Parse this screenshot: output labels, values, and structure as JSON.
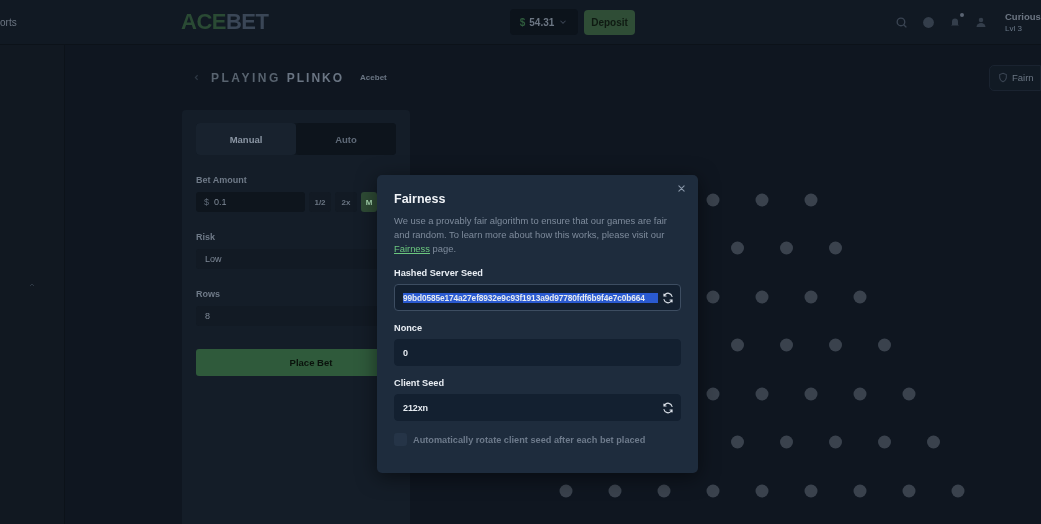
{
  "nav": {
    "label": "orts"
  },
  "header": {
    "logo": {
      "part_1": "ACE",
      "part_2": "BET"
    },
    "balance": {
      "currency": "$",
      "amount": "54.31"
    },
    "deposit": "Deposit",
    "notification_dot": true,
    "user": {
      "name": "Curious",
      "level": "Lvl 3"
    }
  },
  "game": {
    "title_prefix": "PLAYING",
    "title": "PLINKO",
    "provider": "Acebet",
    "fairness_button": "Fairn"
  },
  "controls": {
    "tabs": [
      {
        "label": "Manual",
        "selected": true
      },
      {
        "label": "Auto",
        "selected": false
      }
    ],
    "bet_amount": {
      "label": "Bet Amount",
      "currency": "$",
      "value": "0.1",
      "buttons": [
        {
          "label": "1/2",
          "kind": "plain"
        },
        {
          "label": "2x",
          "kind": "plain"
        },
        {
          "label": "M",
          "kind": "accent"
        }
      ]
    },
    "risk": {
      "label": "Risk",
      "value": "Low"
    },
    "rows": {
      "label": "Rows",
      "value": "8"
    },
    "place_bet": "Place Bet"
  },
  "modal": {
    "title": "Fairness",
    "description": "We use a provably fair algorithm to ensure that our games are fair and random. To learn more about how this works, please visit our ",
    "link": "Fairness",
    "description_end": " page.",
    "fields": [
      {
        "label": "Hashed Server Seed",
        "value": "99bd0585e174a27ef8932e9c93f1913a9d97780fdf6b9f4e7c0b664",
        "text_selected": true,
        "refresh": true
      },
      {
        "label": "Nonce",
        "value": "0",
        "text_selected": false,
        "refresh": false
      },
      {
        "label": "Client Seed",
        "value": "212xn",
        "text_selected": false,
        "refresh": true
      }
    ],
    "auto_rotate": {
      "label": "Automatically rotate client seed after each bet placed",
      "checked": false
    }
  }
}
